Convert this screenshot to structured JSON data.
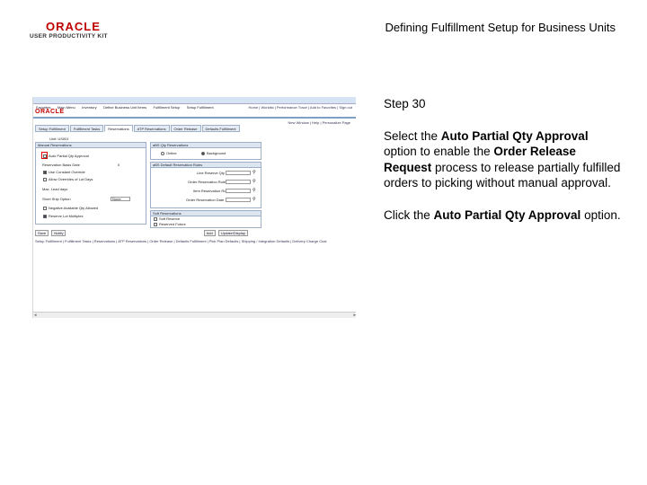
{
  "header": {
    "logo_primary": "ORACLE",
    "logo_secondary": "USER PRODUCTIVITY KIT",
    "title": "Defining Fulfillment Setup for Business Units"
  },
  "screenshot": {
    "nav_items": [
      "Favorites",
      "Main Menu",
      "Inventory",
      "Define Business Unit Items",
      "Fulfillment Setup",
      "Setup Fulfillment"
    ],
    "top_links": [
      "Home",
      "Worklist",
      "Performance Trace",
      "Add to Favorites",
      "Sign out"
    ],
    "logo": "ORACLE",
    "new_window": "New Window | Help | Personalize Page",
    "tabs": [
      "Setup Fulfillment",
      "Fulfillment Tasks",
      "Reservations",
      "ATP Reservations",
      "Order Release",
      "Defaults Fulfillment"
    ],
    "active_tab": 2,
    "unit_label": "Unit: US001",
    "manual_reservations": {
      "header": "Manual Reservations",
      "auto_partial": "Auto Partial Qty Approval",
      "reservation_basis": "Reservation Basis Date",
      "reservation_value": "0",
      "use_constant": "Use Constant Override",
      "allow_overrides": "Allow Overrides of Lot Days",
      "max_days": "Max. Lead days",
      "short_ship": "Short Ship Option",
      "short_ship_value": "None",
      "negative": "Negative Available Qty Allowed",
      "reserve_multiples": "Reserve Lot Multiples"
    },
    "ahs_reservations": {
      "header": "aBS Qty Reservations",
      "option_1": "Online",
      "option_2": "Background"
    },
    "default_reservation": {
      "header": "aBS Default Reservation Rules",
      "fields": [
        "Line Reserve Qty Rule",
        "Order Reservation Rule",
        "Item Reservation Rule",
        "Order Reservation Date"
      ]
    },
    "soft_reservations": {
      "header": "Soft Reservations",
      "item_1": "Soft Reserve",
      "item_2": "Reserved Future"
    },
    "buttons": [
      "Save",
      "Notify",
      "Add",
      "Update/Display"
    ],
    "bottom_links": "Setup Fulfillment | Fulfillment Tasks | Reservations | ATP Reservations | Order Release | Defaults Fulfillment | Pick Plan Defaults | Shipping / Integration Defaults | Delivery Charge Cust"
  },
  "instructions": {
    "step": "Step 30",
    "para1_pre": "Select the ",
    "para1_b1": "Auto Partial Qty Approval",
    "para1_mid": " option to enable the ",
    "para1_b2": "Order Release Request",
    "para1_post": " process to release partially fulfilled orders to picking without manual approval.",
    "para2_pre": "Click the ",
    "para2_b1": "Auto Partial Qty Approval",
    "para2_post": " option."
  }
}
